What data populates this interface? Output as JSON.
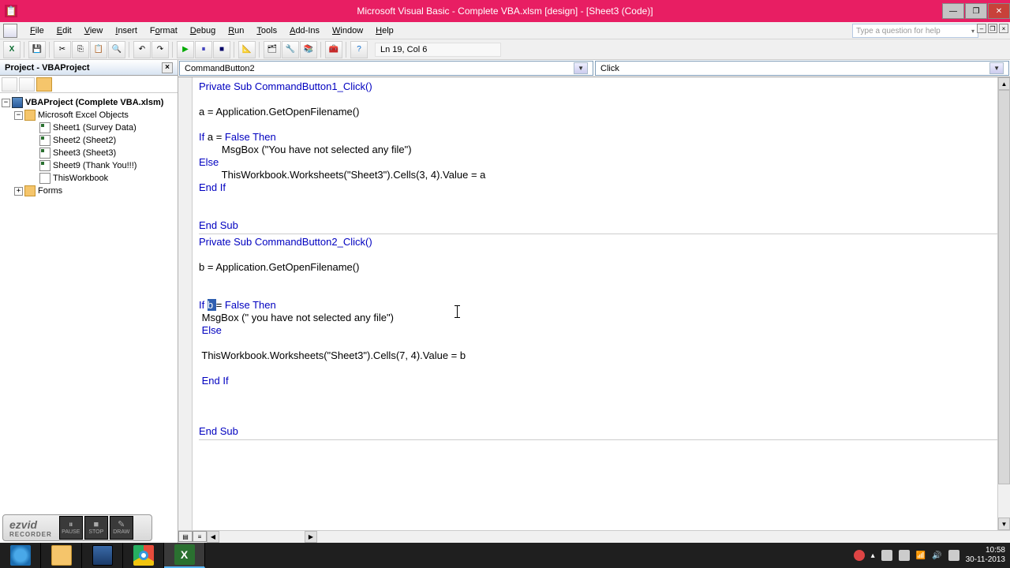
{
  "window": {
    "title": "Microsoft Visual Basic - Complete VBA.xlsm [design] - [Sheet3 (Code)]"
  },
  "menu": {
    "items": [
      "File",
      "Edit",
      "View",
      "Insert",
      "Format",
      "Debug",
      "Run",
      "Tools",
      "Add-Ins",
      "Window",
      "Help"
    ],
    "help_placeholder": "Type a question for help"
  },
  "toolbar": {
    "lncol": "Ln 19, Col 6"
  },
  "project": {
    "title": "Project - VBAProject",
    "root": "VBAProject (Complete VBA.xlsm)",
    "group": "Microsoft Excel Objects",
    "sheets": [
      "Sheet1 (Survey Data)",
      "Sheet2 (Sheet2)",
      "Sheet3 (Sheet3)",
      "Sheet9 (Thank You!!!)",
      "ThisWorkbook"
    ],
    "forms": "Forms"
  },
  "code_header": {
    "object": "CommandButton2",
    "proc": "Click"
  },
  "code": {
    "l1": "Private Sub CommandButton1_Click()",
    "l2": "",
    "l3": "a = Application.GetOpenFilename()",
    "l4": "",
    "l5a": "If",
    "l5b": " a = ",
    "l5c": "False Then",
    "l6": "        MsgBox (\"You have not selected any file\")",
    "l7": "Else",
    "l8": "        ThisWorkbook.Worksheets(\"Sheet3\").Cells(3, 4).Value = a",
    "l9": "End If",
    "l10": "",
    "l11": "",
    "l12": "End Sub",
    "l13": "Private Sub CommandButton2_Click()",
    "l14": "",
    "l15": "b = Application.GetOpenFilename()",
    "l16": "",
    "l17": "",
    "l18a": "If ",
    "l18sel": "b ",
    "l18b": "= ",
    "l18c": "False Then",
    "l19": " MsgBox (\" you have not selected any file\")",
    "l20": " Else",
    "l21": "",
    "l22": " ThisWorkbook.Worksheets(\"Sheet3\").Cells(7, 4).Value = b",
    "l23": "",
    "l24": " End If",
    "l25": "",
    "l26": "",
    "l27": "",
    "l28": "End Sub"
  },
  "ezvid": {
    "btns": [
      "PAUSE",
      "STOP",
      "DRAW"
    ]
  },
  "clock": {
    "time": "10:58",
    "date": "30-11-2013"
  }
}
